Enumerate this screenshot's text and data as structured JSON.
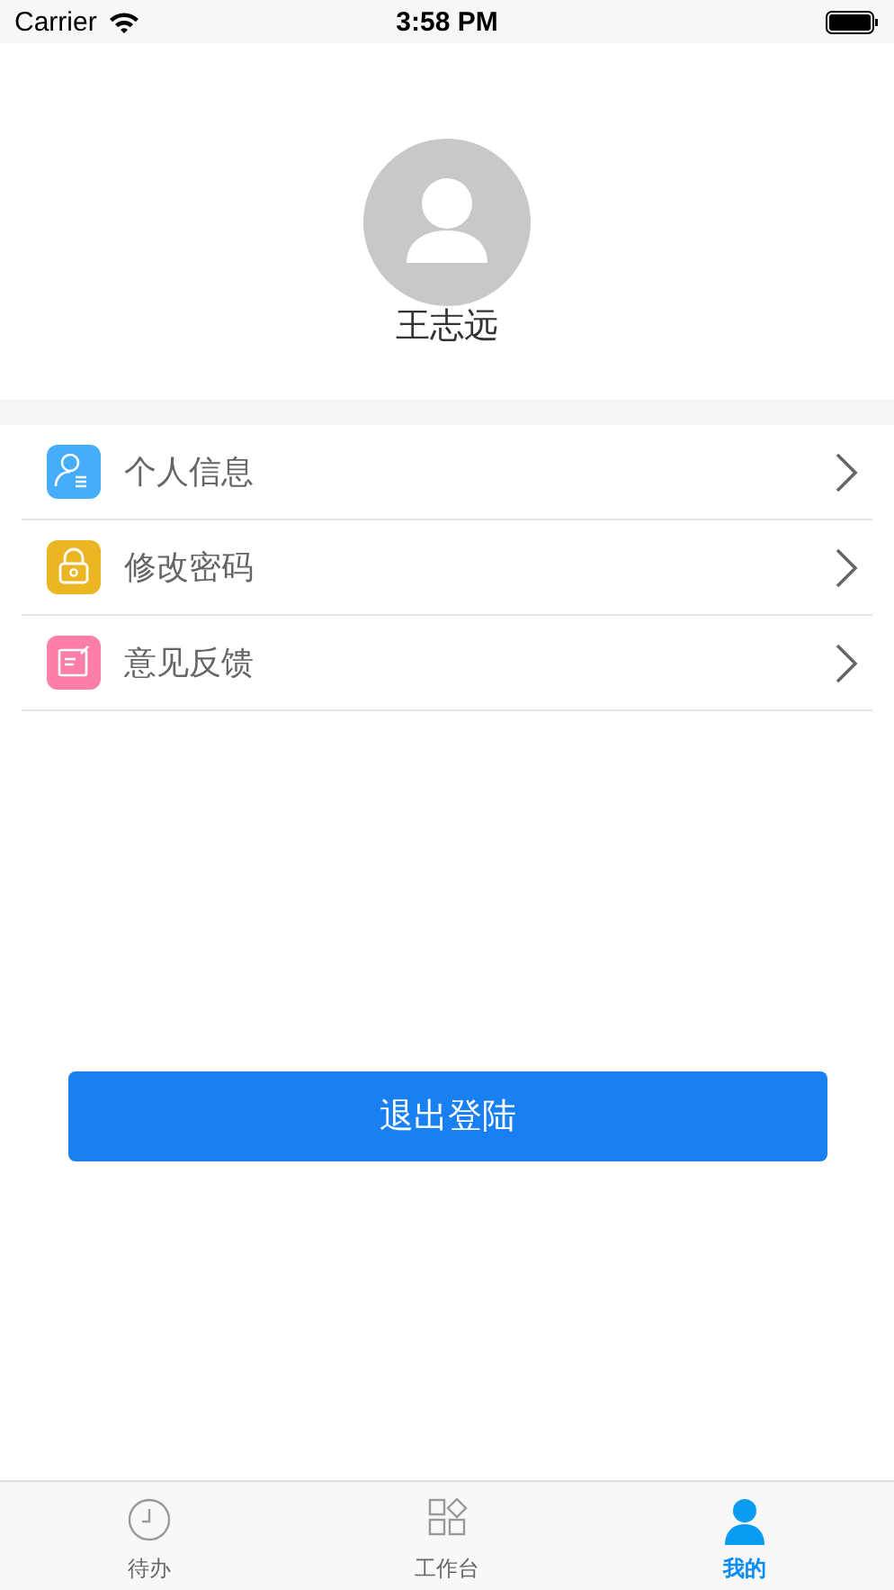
{
  "status_bar": {
    "carrier": "Carrier",
    "time": "3:58 PM"
  },
  "profile": {
    "name": "王志远"
  },
  "menu": [
    {
      "label": "个人信息",
      "kind": "person",
      "color": "#44aefc"
    },
    {
      "label": "修改密码",
      "kind": "lock",
      "color": "#ebb523"
    },
    {
      "label": "意见反馈",
      "kind": "note",
      "color": "#fd7fa7"
    }
  ],
  "logout_button": "退出登陆",
  "tabs": [
    {
      "label": "待办",
      "kind": "clock",
      "selected": false
    },
    {
      "label": "工作台",
      "kind": "grid",
      "selected": false
    },
    {
      "label": "我的",
      "kind": "person",
      "selected": true
    }
  ]
}
